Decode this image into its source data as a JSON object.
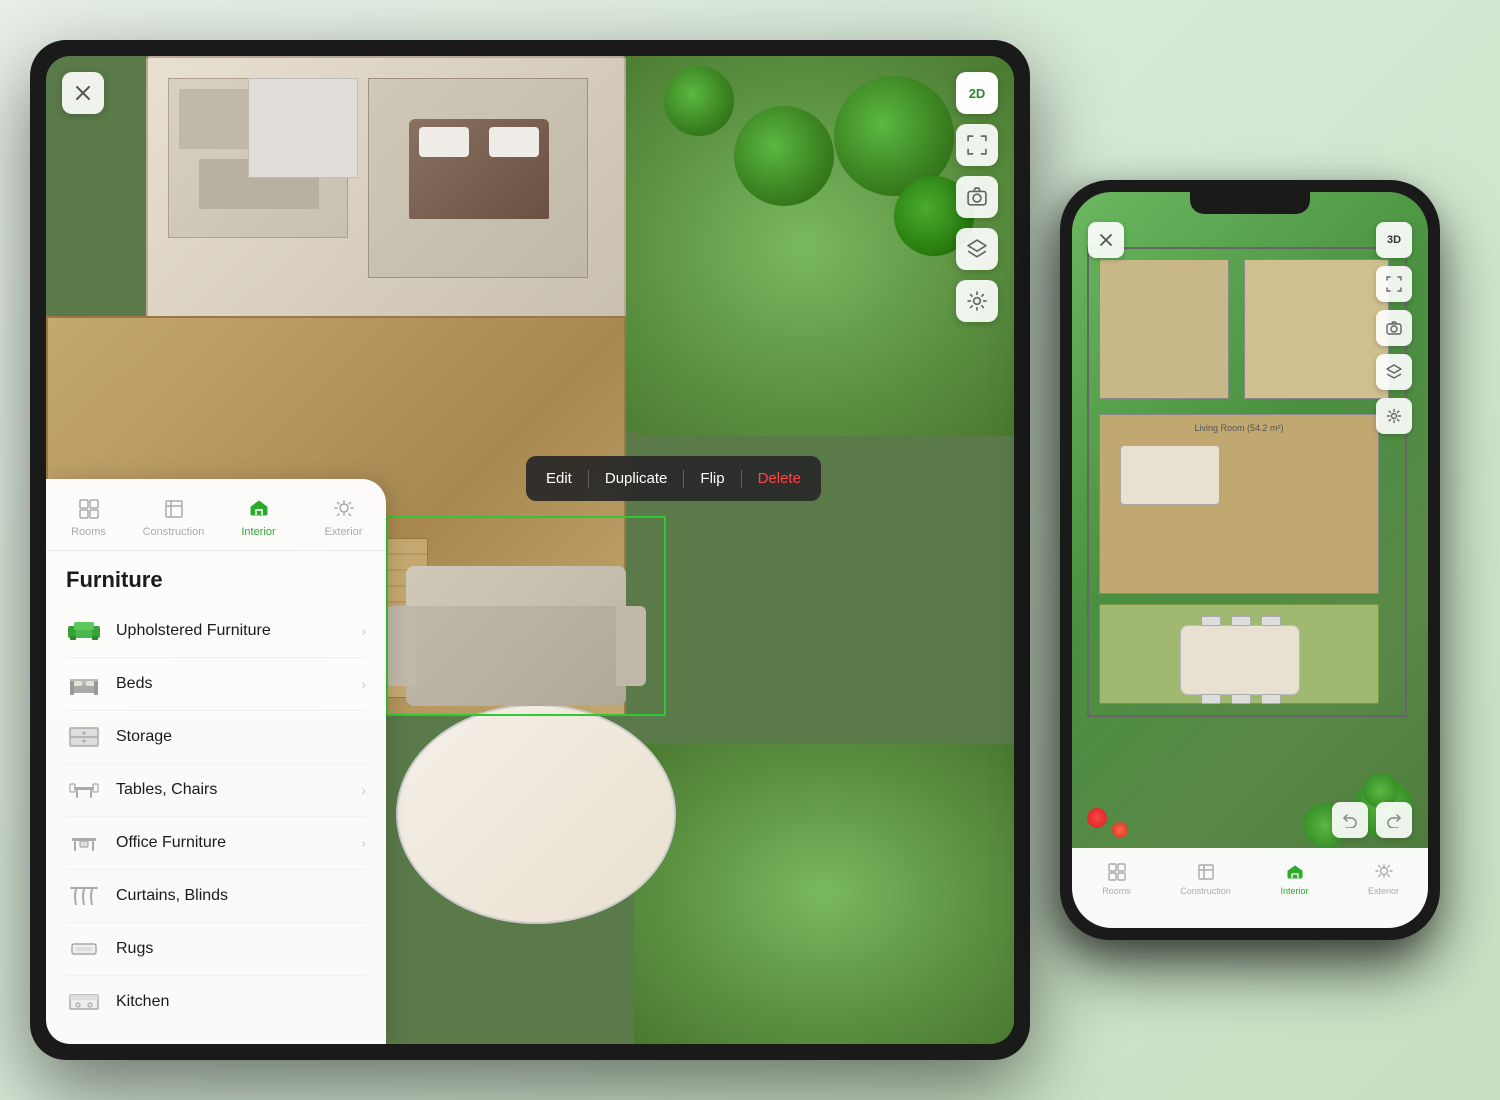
{
  "scene": {
    "background_color": "#e8f0e0"
  },
  "tablet": {
    "close_button_symbol": "✕",
    "top_bar_buttons": [
      {
        "label": "2D",
        "icon": "2d-icon"
      },
      {
        "label": "⊹",
        "icon": "expand-icon"
      },
      {
        "label": "📷",
        "icon": "camera-icon"
      },
      {
        "label": "⊕",
        "icon": "layers-icon"
      },
      {
        "label": "⚙",
        "icon": "settings-icon"
      }
    ],
    "context_menu": {
      "items": [
        "Edit",
        "Duplicate",
        "Flip",
        "Delete"
      ]
    },
    "sidebar": {
      "tabs": [
        {
          "label": "Rooms",
          "icon": "rooms-icon",
          "active": false
        },
        {
          "label": "Construction",
          "icon": "construction-icon",
          "active": false
        },
        {
          "label": "Interior",
          "icon": "interior-icon",
          "active": true
        },
        {
          "label": "Exterior",
          "icon": "exterior-icon",
          "active": false
        }
      ],
      "section_title": "Furniture",
      "items": [
        {
          "name": "Upholstered Furniture",
          "icon": "sofa-icon",
          "has_submenu": true
        },
        {
          "name": "Beds",
          "icon": "bed-icon",
          "has_submenu": true
        },
        {
          "name": "Storage",
          "icon": "storage-icon",
          "has_submenu": false
        },
        {
          "name": "Tables, Chairs",
          "icon": "table-chair-icon",
          "has_submenu": true
        },
        {
          "name": "Office Furniture",
          "icon": "office-icon",
          "has_submenu": true
        },
        {
          "name": "Curtains, Blinds",
          "icon": "curtain-icon",
          "has_submenu": false
        },
        {
          "name": "Rugs",
          "icon": "rug-icon",
          "has_submenu": false
        },
        {
          "name": "Kitchen",
          "icon": "kitchen-icon",
          "has_submenu": false
        }
      ]
    }
  },
  "phone": {
    "close_button_symbol": "✕",
    "top_bar_buttons": [
      {
        "label": "3D",
        "icon": "3d-icon"
      },
      {
        "label": "⊹",
        "icon": "expand-icon"
      },
      {
        "label": "📷",
        "icon": "camera-icon"
      },
      {
        "label": "⊕",
        "icon": "layers-icon"
      },
      {
        "label": "⚙",
        "icon": "settings-icon"
      }
    ],
    "room_label": "Living Room (54.2 m²)",
    "undo_label": "↩",
    "redo_label": "↪",
    "tabs": [
      {
        "label": "Rooms",
        "icon": "rooms-icon",
        "active": false
      },
      {
        "label": "Construction",
        "icon": "construction-icon",
        "active": false
      },
      {
        "label": "Interior",
        "icon": "interior-icon",
        "active": true
      },
      {
        "label": "Exterior",
        "icon": "exterior-icon",
        "active": false
      }
    ]
  }
}
